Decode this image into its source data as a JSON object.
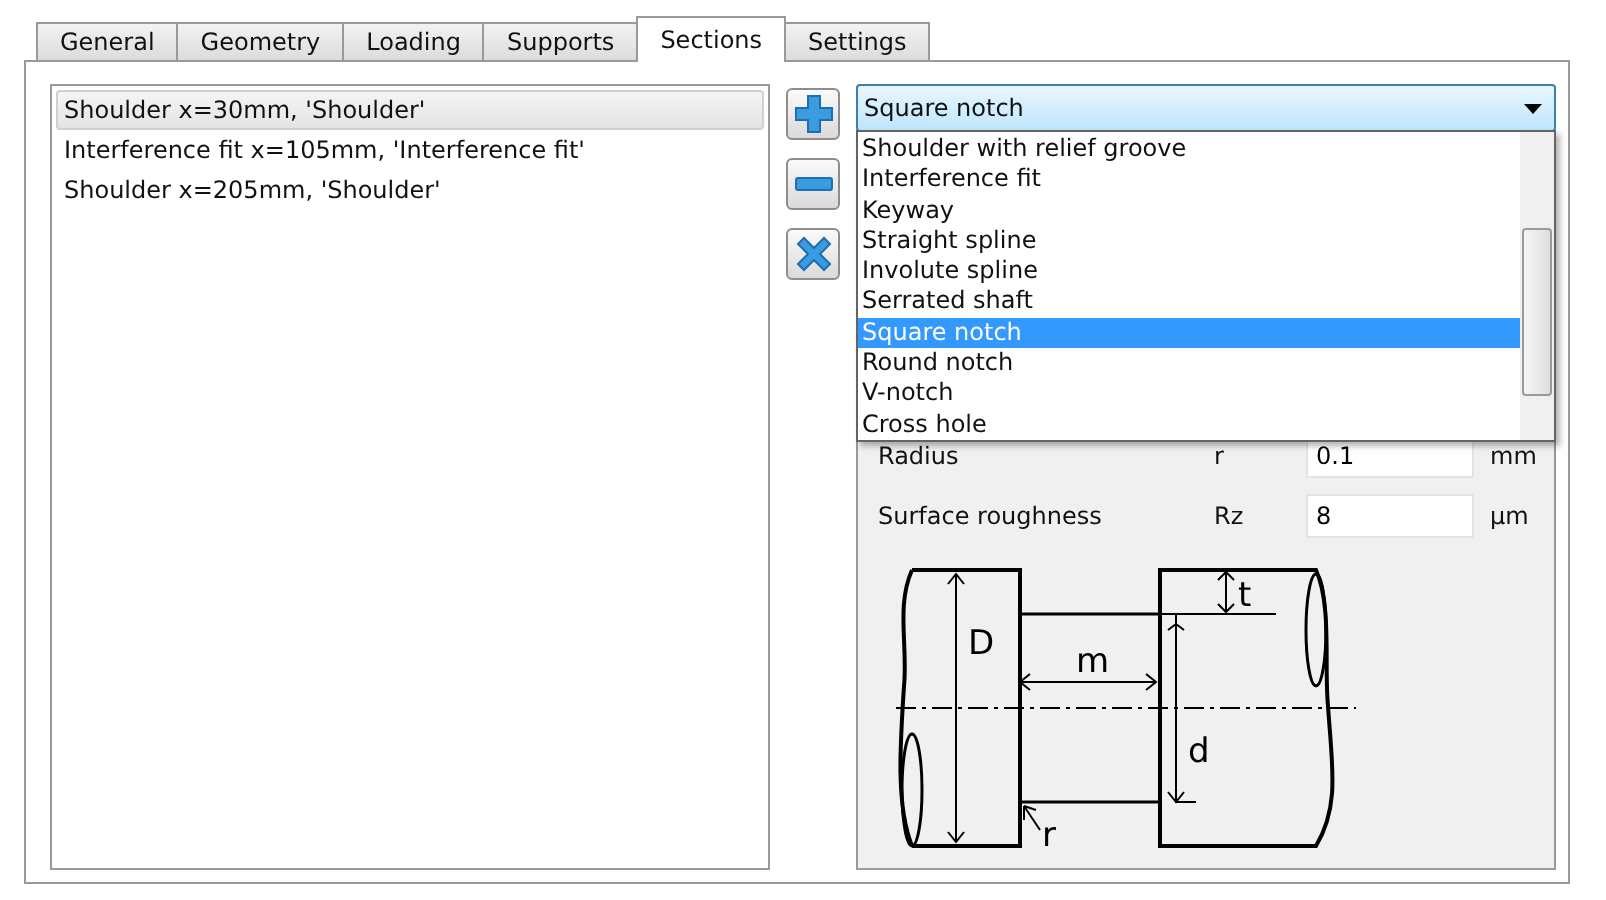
{
  "tabs": [
    {
      "label": "General",
      "selected": false
    },
    {
      "label": "Geometry",
      "selected": false
    },
    {
      "label": "Loading",
      "selected": false
    },
    {
      "label": "Supports",
      "selected": false
    },
    {
      "label": "Sections",
      "selected": true
    },
    {
      "label": "Settings",
      "selected": false
    }
  ],
  "sections": [
    {
      "label": "Shoulder x=30mm, 'Shoulder'",
      "selected": true
    },
    {
      "label": "Interference fit x=105mm, 'Interference fit'",
      "selected": false
    },
    {
      "label": "Shoulder x=205mm, 'Shoulder'",
      "selected": false
    }
  ],
  "section_type": {
    "value": "Square notch",
    "options": [
      {
        "label": "Shoulder with relief groove",
        "selected": false
      },
      {
        "label": "Interference fit",
        "selected": false
      },
      {
        "label": "Keyway",
        "selected": false
      },
      {
        "label": "Straight spline",
        "selected": false
      },
      {
        "label": "Involute spline",
        "selected": false
      },
      {
        "label": "Serrated shaft",
        "selected": false
      },
      {
        "label": "Square notch",
        "selected": true
      },
      {
        "label": "Round notch",
        "selected": false
      },
      {
        "label": "V-notch",
        "selected": false
      },
      {
        "label": "Cross hole",
        "selected": false
      }
    ]
  },
  "parameters": [
    {
      "label": "Radius",
      "symbol": "r",
      "value": "0.1",
      "unit": "mm"
    },
    {
      "label": "Surface roughness",
      "symbol": "Rz",
      "value": "8",
      "unit": "µm"
    }
  ],
  "drawing_labels": {
    "outer_diameter": "D",
    "width": "m",
    "depth": "t",
    "inner_diameter": "d",
    "radius": "r"
  }
}
